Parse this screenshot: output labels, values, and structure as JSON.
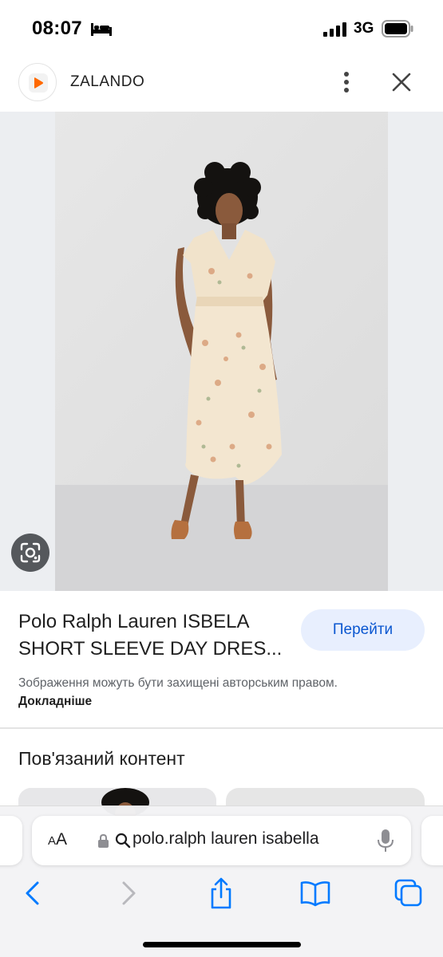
{
  "status_bar": {
    "time": "08:07",
    "network": "3G",
    "icons": [
      "bed-icon",
      "cell-signal-icon",
      "battery-icon"
    ]
  },
  "header": {
    "site_name": "ZALANDO",
    "icons": [
      "zalando-logo-icon",
      "more-vertical-icon",
      "close-icon"
    ]
  },
  "product": {
    "image_alt": "Model wearing a cream floral midi wrap dress with short sleeves",
    "title": "Polo Ralph Lauren ISBELA SHORT SLEEVE DAY DRES...",
    "visit_label": "Перейти",
    "copyright_text": "Зображення можуть бути захищені авторським правом.",
    "more_link": "Докладніше"
  },
  "related": {
    "title": "Пов'язаний контент"
  },
  "browser": {
    "aa_label_small": "A",
    "aa_label_large": "A",
    "address": "polo.ralph lauren isabella",
    "toolbar": [
      "back-icon",
      "forward-icon",
      "share-icon",
      "bookmarks-icon",
      "tabs-icon"
    ]
  },
  "colors": {
    "accent": "#0b57d0",
    "visit_bg": "#e8effe",
    "image_bg": "#eceef1",
    "ios_blue": "#007aff"
  }
}
